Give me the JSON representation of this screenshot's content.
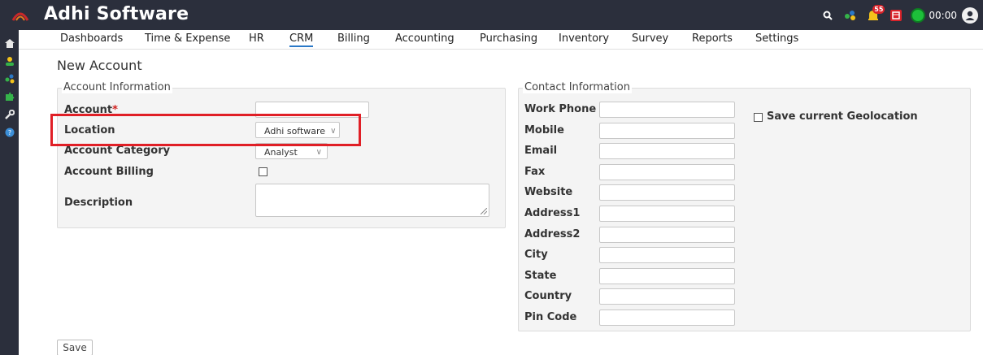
{
  "app": {
    "brand": "Adhi Software"
  },
  "header": {
    "notification_count": "55",
    "timer": "00:00"
  },
  "nav": {
    "tabs": [
      "Dashboards",
      "Time & Expense",
      "HR",
      "CRM",
      "Billing",
      "Accounting",
      "Purchasing",
      "Inventory",
      "Survey",
      "Reports",
      "Settings"
    ],
    "active": "CRM"
  },
  "page": {
    "title": "New Account"
  },
  "account_info": {
    "title": "Account Information",
    "account_label": "Account",
    "required_mark": "*",
    "account_value": "",
    "location_label": "Location",
    "location_value": "Adhi software",
    "category_label": "Account Category",
    "category_value": "Analyst",
    "billing_label": "Account Billing",
    "billing_checked": false,
    "description_label": "Description",
    "description_value": ""
  },
  "contact_info": {
    "title": "Contact Information",
    "fields": [
      "Work Phone",
      "Mobile",
      "Email",
      "Fax",
      "Website",
      "Address1",
      "Address2",
      "City",
      "State",
      "Country",
      "Pin Code"
    ],
    "geo_label": "Save current Geolocation",
    "geo_checked": false
  },
  "actions": {
    "save_label": "Save"
  },
  "colors": {
    "topbar": "#2b2f3c",
    "accent": "#2a78c7",
    "highlight": "#e01f26"
  }
}
